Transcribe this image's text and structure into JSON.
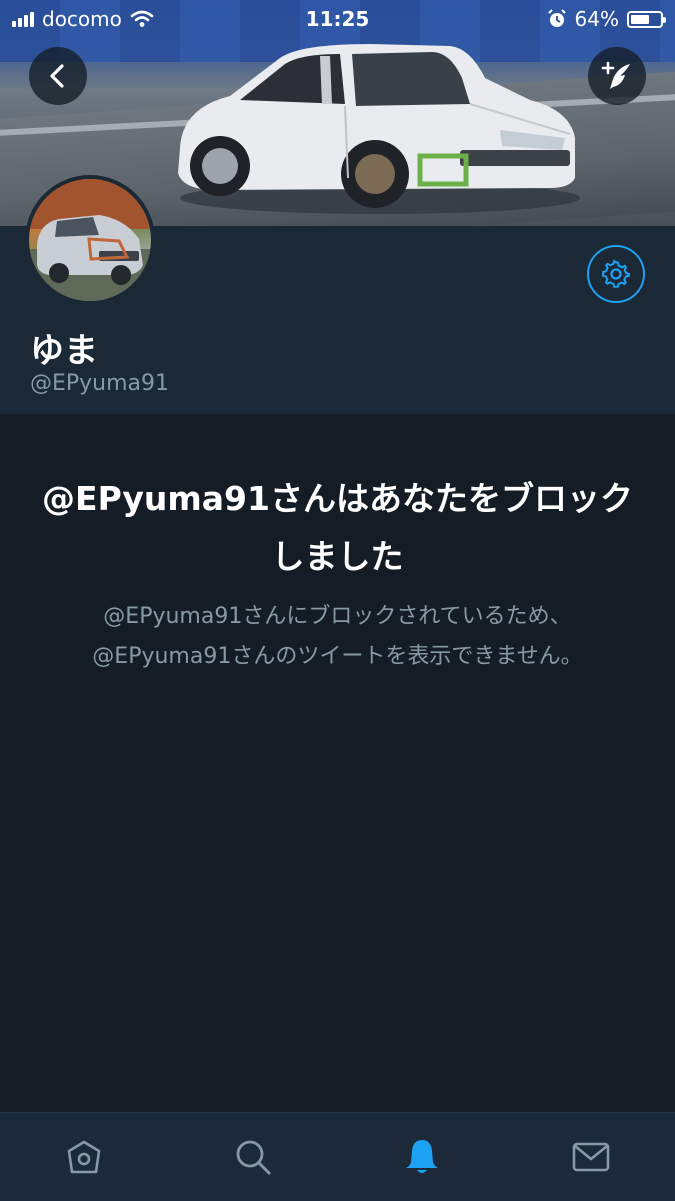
{
  "status_bar": {
    "carrier": "docomo",
    "time": "11:25",
    "battery": "64%",
    "battery_level": 0.64,
    "signal_bars": 4
  },
  "header": {
    "back_icon": "chevron-left-icon",
    "compose_icon": "compose-tweet-icon"
  },
  "profile": {
    "display_name": "ゆま",
    "handle": "@EPyuma91",
    "settings_icon": "gear-icon"
  },
  "blocked": {
    "title": "@EPyuma91さんはあなたをブロックしました",
    "description": "@EPyuma91さんにブロックされているため、@EPyuma91さんのツイートを表示できません。"
  },
  "tabs": [
    {
      "name": "home",
      "icon": "home-icon"
    },
    {
      "name": "search",
      "icon": "search-icon"
    },
    {
      "name": "notifications",
      "icon": "bell-icon",
      "active": true
    },
    {
      "name": "messages",
      "icon": "envelope-icon"
    }
  ],
  "colors": {
    "background": "#141d26",
    "panel": "#1b2836",
    "accent": "#1da1f2",
    "secondary_text": "#8899a6"
  }
}
